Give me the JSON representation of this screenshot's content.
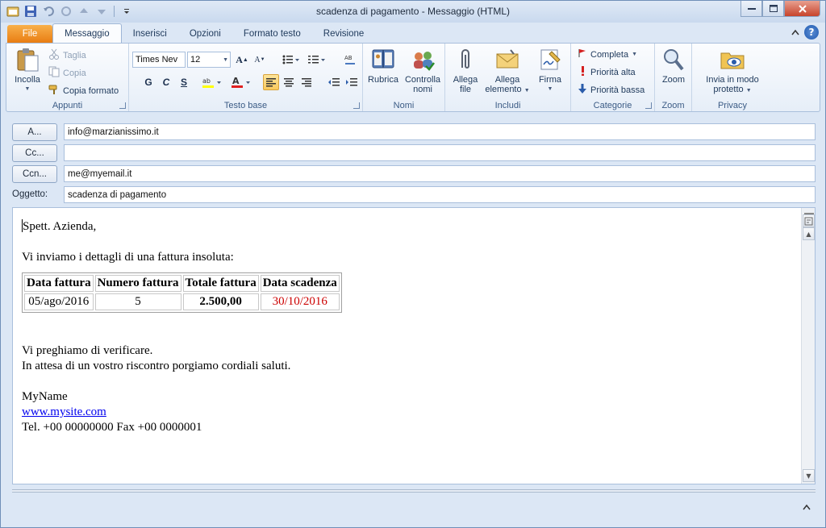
{
  "window": {
    "title": "scadenza di pagamento  -  Messaggio (HTML)"
  },
  "tabs": [
    "File",
    "Messaggio",
    "Inserisci",
    "Opzioni",
    "Formato testo",
    "Revisione"
  ],
  "ribbon": {
    "appunti": {
      "label": "Appunti",
      "paste": "Incolla",
      "cut": "Taglia",
      "copy": "Copia",
      "format_painter": "Copia formato"
    },
    "testo_base": {
      "label": "Testo base",
      "font": "Times Nev",
      "size": "12",
      "bold": "G",
      "italic": "C",
      "underline": "S"
    },
    "nomi": {
      "label": "Nomi",
      "address_book": "Rubrica",
      "check_names_1": "Controlla",
      "check_names_2": "nomi"
    },
    "includi": {
      "label": "Includi",
      "attach_file_1": "Allega",
      "attach_file_2": "file",
      "attach_item_1": "Allega",
      "attach_item_2": "elemento",
      "signature": "Firma"
    },
    "categorie": {
      "label": "Categorie",
      "follow_up": "Completa",
      "high": "Priorità alta",
      "low": "Priorità bassa"
    },
    "zoom": {
      "label": "Zoom",
      "button": "Zoom"
    },
    "privacy": {
      "label": "Privacy",
      "protected_1": "Invia in modo",
      "protected_2": "protetto"
    }
  },
  "header": {
    "to_button": "A...",
    "to_value": "info@marzianissimo.it",
    "cc_button": "Cc...",
    "cc_value": "",
    "bcc_button": "Ccn...",
    "bcc_value": "me@myemail.it",
    "subject_label": "Oggetto:",
    "subject_value": "scadenza di pagamento"
  },
  "body": {
    "greeting": "Spett. Azienda,",
    "intro": "Vi inviamo i dettagli di una fattura insoluta:",
    "table": {
      "headers": [
        "Data fattura",
        "Numero fattura",
        "Totale fattura",
        "Data scadenza"
      ],
      "row": [
        "05/ago/2016",
        "5",
        "2.500,00",
        "30/10/2016"
      ]
    },
    "line1": "Vi preghiamo di verificare.",
    "line2": "In attesa di un vostro riscontro porgiamo cordiali saluti.",
    "name": "MyName",
    "site": "www.mysite.com",
    "contacts": "Tel. +00 00000000 Fax +00 0000001"
  },
  "colors": {
    "accent_orange": "#e97d13",
    "due_date_red": "#cc0000",
    "link_blue": "#0000ee"
  }
}
